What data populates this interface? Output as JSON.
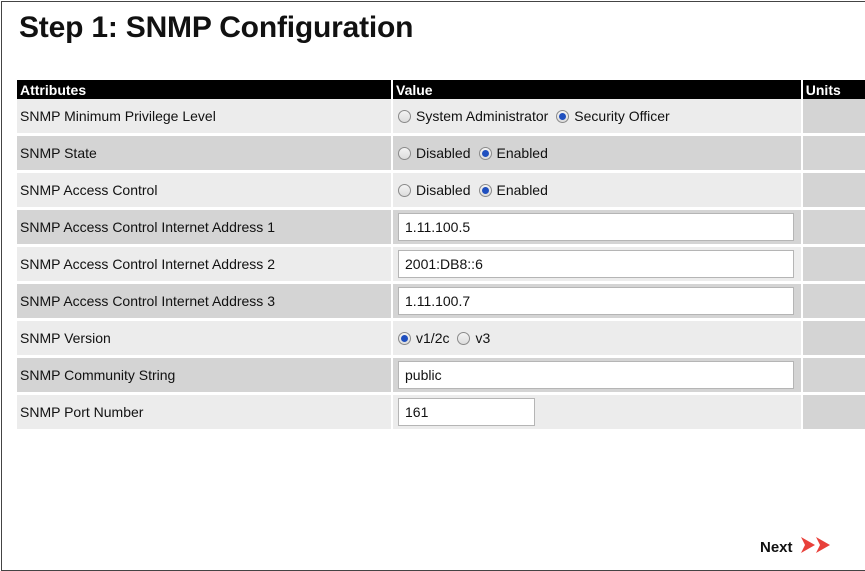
{
  "title": "Step 1: SNMP Configuration",
  "table": {
    "headers": {
      "attributes": "Attributes",
      "value": "Value",
      "units": "Units"
    }
  },
  "rows": {
    "min_privilege": {
      "label": "SNMP Minimum Privilege Level",
      "options": [
        "System Administrator",
        "Security Officer"
      ],
      "selected": "Security Officer"
    },
    "state": {
      "label": "SNMP State",
      "options": [
        "Disabled",
        "Enabled"
      ],
      "selected": "Enabled"
    },
    "access_control": {
      "label": "SNMP Access Control",
      "options": [
        "Disabled",
        "Enabled"
      ],
      "selected": "Enabled"
    },
    "addr1": {
      "label": "SNMP Access Control Internet Address 1",
      "value": "1.11.100.5"
    },
    "addr2": {
      "label": "SNMP Access Control Internet Address 2",
      "value": "2001:DB8::6"
    },
    "addr3": {
      "label": "SNMP Access Control Internet Address 3",
      "value": "1.11.100.7"
    },
    "version": {
      "label": "SNMP Version",
      "options": [
        "v1/2c",
        "v3"
      ],
      "selected": "v1/2c"
    },
    "community": {
      "label": "SNMP Community String",
      "value": "public"
    },
    "port": {
      "label": "SNMP Port Number",
      "value": "161"
    }
  },
  "next": {
    "label": "Next",
    "icon": "double-chevron-right-icon",
    "color": "#e8403a"
  },
  "colors": {
    "header_bg": "#000000",
    "row_light": "#ececec",
    "row_dark": "#d4d4d4",
    "radio_selected": "#1f4fbf"
  }
}
